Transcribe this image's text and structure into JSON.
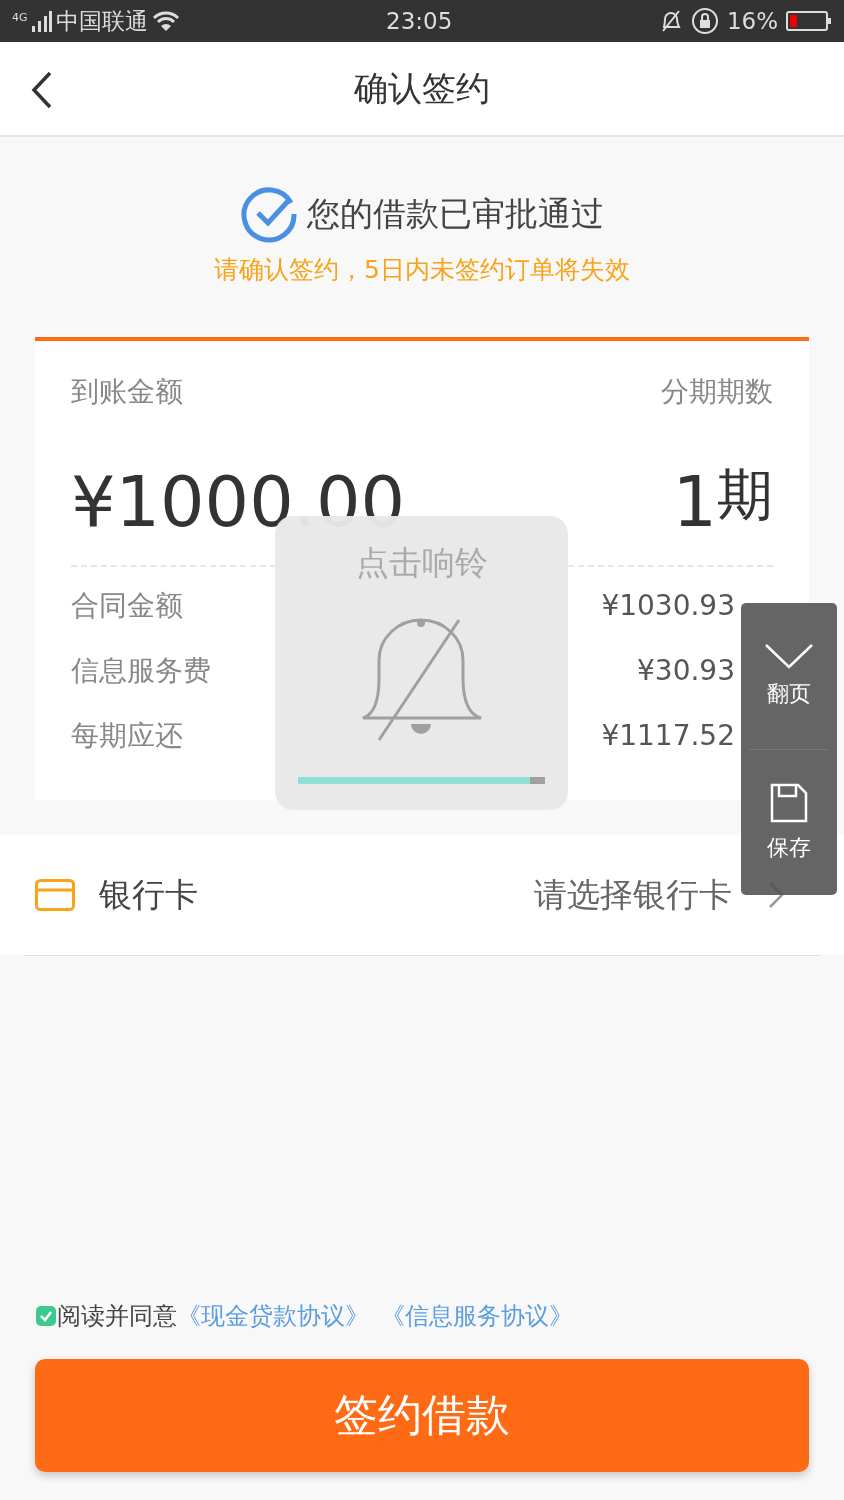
{
  "status_bar": {
    "network": "4G",
    "carrier": "中国联通",
    "time": "23:05",
    "battery": "16%"
  },
  "header": {
    "title": "确认签约"
  },
  "approval": {
    "title": "您的借款已审批通过",
    "notice": "请确认签约，5日内未签约订单将失效"
  },
  "loan": {
    "amount_label": "到账金额",
    "periods_label": "分期期数",
    "amount": "¥1000.00",
    "periods": "1",
    "periods_unit": "期",
    "details": [
      {
        "label": "合同金额",
        "value": "¥1030.93"
      },
      {
        "label": "信息服务费",
        "value": "¥30.93"
      },
      {
        "label": "每期应还",
        "value": "¥1117.52"
      }
    ]
  },
  "bank_card": {
    "label": "银行卡",
    "prompt": "请选择银行卡"
  },
  "agreement": {
    "checked": true,
    "text": "阅读并同意",
    "links": [
      "《现金贷款协议》",
      "《信息服务协议》"
    ]
  },
  "submit_button": "签约借款",
  "ring_toast": {
    "title": "点击响铃",
    "level": 0.94
  },
  "side_panel": {
    "items": [
      {
        "kind": "page-down",
        "label": "翻页"
      },
      {
        "kind": "save",
        "label": "保存"
      }
    ]
  }
}
